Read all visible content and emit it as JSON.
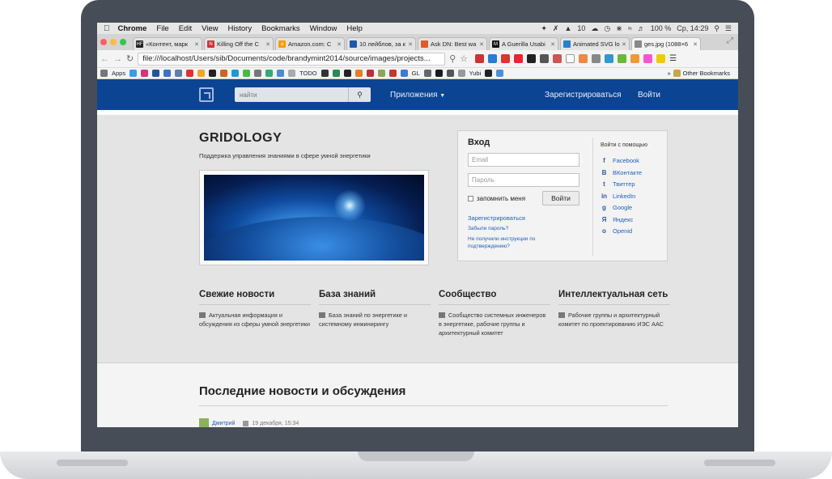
{
  "menubar": {
    "app": "Chrome",
    "items": [
      "File",
      "Edit",
      "View",
      "History",
      "Bookmarks",
      "Window",
      "Help"
    ],
    "tray_number": "10",
    "battery": "100 %",
    "clock": "Ср, 14:29"
  },
  "tabs": [
    {
      "title": "«Контент, марк",
      "favicon": "HF",
      "color": "#222"
    },
    {
      "title": "Killing Off the C",
      "favicon": "N",
      "color": "#c33"
    },
    {
      "title": "Amazon.com: C",
      "favicon": "a",
      "color": "#f90"
    },
    {
      "title": "10 лейблов, за к",
      "favicon": "",
      "color": "#2255aa"
    },
    {
      "title": "Ask DN: Best wa",
      "favicon": "",
      "color": "#e05b2a"
    },
    {
      "title": "A Guerilla Usabi",
      "favicon": "M",
      "color": "#111"
    },
    {
      "title": "Animated SVG lo",
      "favicon": "",
      "color": "#2a80c8"
    },
    {
      "title": "ges.jpg (1088×6",
      "favicon": "",
      "color": "#888",
      "active": true
    }
  ],
  "toolbar": {
    "url": "file:///localhost/Users/sib/Documents/code/brandymint2014/source/images/projects..."
  },
  "bookmarks": {
    "apps_label": "Apps",
    "todo_label": "TODO",
    "gl_label": "GL",
    "yubi_label": "Yubi",
    "other_label": "Other Bookmarks"
  },
  "site": {
    "search_placeholder": "найти",
    "apps_menu": "Приложения",
    "register": "Зарегистрироваться",
    "login": "Войти",
    "brand": "GRIDOLOGY",
    "tagline": "Поддержка управления знаниями в сфере умной энергетики",
    "login_box": {
      "title": "Вход",
      "email_placeholder": "Email",
      "password_placeholder": "Пароль",
      "remember": "запомнить меня",
      "submit": "Войти",
      "register_link": "Зарегистрироваться",
      "forgot_link": "Забыли пароль?",
      "no_instructions_link": "Не получили инструкции по подтверждению?",
      "social_title": "Войти с помощью",
      "social": [
        {
          "label": "Facebook",
          "icon": "facebook-icon",
          "glyph": "f"
        },
        {
          "label": "ВКонтакте",
          "icon": "vkontakte-icon",
          "glyph": "B"
        },
        {
          "label": "Твиттер",
          "icon": "twitter-icon",
          "glyph": "t"
        },
        {
          "label": "LinkedIn",
          "icon": "linkedin-icon",
          "glyph": "in"
        },
        {
          "label": "Google",
          "icon": "google-icon",
          "glyph": "g"
        },
        {
          "label": "Яндекс",
          "icon": "yandex-icon",
          "glyph": "Я"
        },
        {
          "label": "Openid",
          "icon": "openid-icon",
          "glyph": "o"
        }
      ]
    },
    "columns": [
      {
        "title": "Свежие новости",
        "text": "Актуальная информация и обсуждения из сферы умной энергетики"
      },
      {
        "title": "База знаний",
        "text": "База знаний по энергетике и системному инжинирингу"
      },
      {
        "title": "Сообщество",
        "text": "Сообщество системных инженеров в энергетике, рабочие группы и архитектурный комитет"
      },
      {
        "title": "Интеллектуальная сеть",
        "text": "Рабочие группы и архитектурный комитет по проектированию ИЭС ААС"
      }
    ],
    "news": {
      "title": "Последние новости и обсуждения",
      "author": "Дмитрий",
      "date": "19 декабря, 15:34"
    }
  },
  "colors": {
    "header_blue": "#0c4494",
    "link_blue": "#1e5fb8",
    "laptop_bezel": "#474d56"
  }
}
